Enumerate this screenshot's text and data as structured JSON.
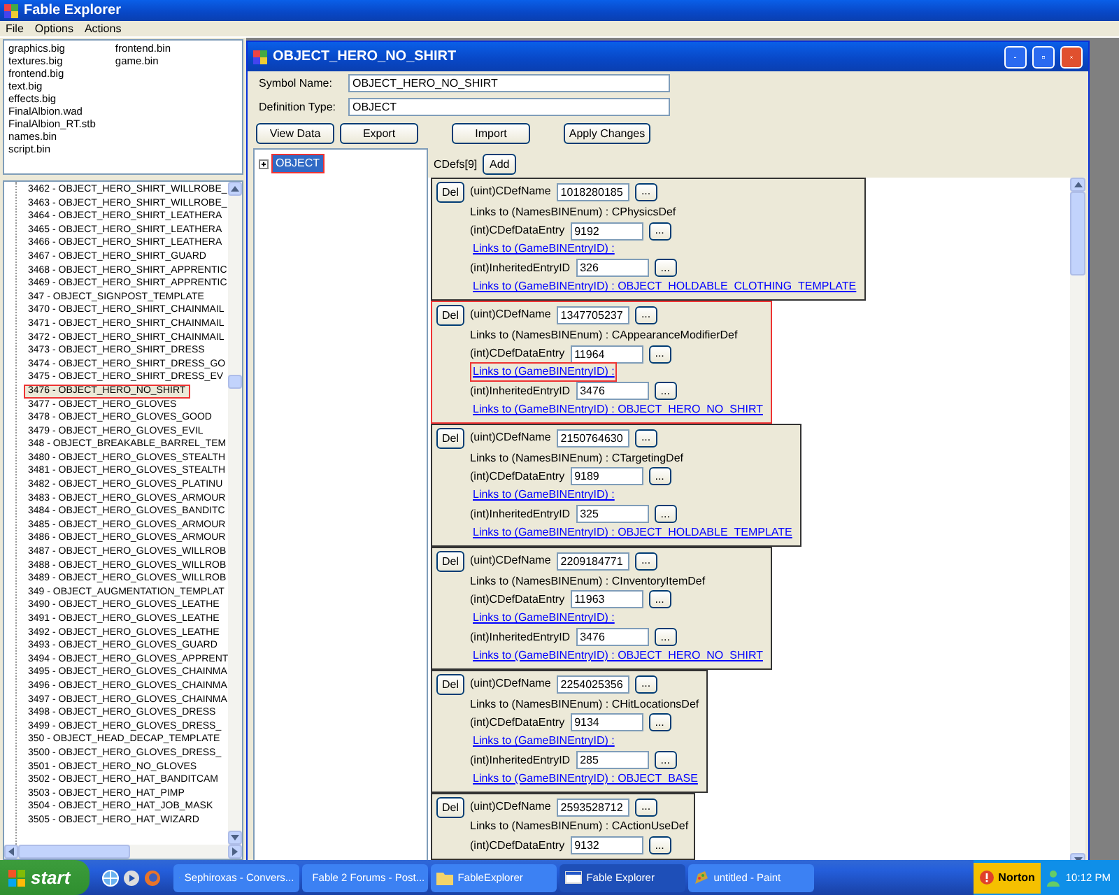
{
  "window": {
    "title": "Fable Explorer"
  },
  "menu": [
    {
      "label": "File"
    },
    {
      "label": "Options"
    },
    {
      "label": "Actions"
    }
  ],
  "files": {
    "columns": [
      [
        "graphics.big",
        "textures.big",
        "frontend.big",
        "text.big",
        "effects.big",
        "FinalAlbion.wad",
        "FinalAlbion_RT.stb",
        "names.bin",
        "script.bin"
      ],
      [
        "frontend.bin",
        "game.bin"
      ]
    ]
  },
  "entries": [
    {
      "text": "3462 - OBJECT_HERO_SHIRT_WILLROBE_",
      "selected": false
    },
    {
      "text": "3463 - OBJECT_HERO_SHIRT_WILLROBE_",
      "selected": false
    },
    {
      "text": "3464 - OBJECT_HERO_SHIRT_LEATHERA",
      "selected": false
    },
    {
      "text": "3465 - OBJECT_HERO_SHIRT_LEATHERA",
      "selected": false
    },
    {
      "text": "3466 - OBJECT_HERO_SHIRT_LEATHERA",
      "selected": false
    },
    {
      "text": "3467 - OBJECT_HERO_SHIRT_GUARD",
      "selected": false
    },
    {
      "text": "3468 - OBJECT_HERO_SHIRT_APPRENTIC",
      "selected": false
    },
    {
      "text": "3469 - OBJECT_HERO_SHIRT_APPRENTIC",
      "selected": false
    },
    {
      "text": "347 - OBJECT_SIGNPOST_TEMPLATE",
      "selected": false
    },
    {
      "text": "3470 - OBJECT_HERO_SHIRT_CHAINMAIL",
      "selected": false
    },
    {
      "text": "3471 - OBJECT_HERO_SHIRT_CHAINMAIL",
      "selected": false
    },
    {
      "text": "3472 - OBJECT_HERO_SHIRT_CHAINMAIL",
      "selected": false
    },
    {
      "text": "3473 - OBJECT_HERO_SHIRT_DRESS",
      "selected": false
    },
    {
      "text": "3474 - OBJECT_HERO_SHIRT_DRESS_GO",
      "selected": false
    },
    {
      "text": "3475 - OBJECT_HERO_SHIRT_DRESS_EV",
      "selected": false
    },
    {
      "text": "3476 - OBJECT_HERO_NO_SHIRT",
      "selected": true
    },
    {
      "text": "3477 - OBJECT_HERO_GLOVES",
      "selected": false
    },
    {
      "text": "3478 - OBJECT_HERO_GLOVES_GOOD",
      "selected": false
    },
    {
      "text": "3479 - OBJECT_HERO_GLOVES_EVIL",
      "selected": false
    },
    {
      "text": "348 - OBJECT_BREAKABLE_BARREL_TEM",
      "selected": false
    },
    {
      "text": "3480 - OBJECT_HERO_GLOVES_STEALTH",
      "selected": false
    },
    {
      "text": "3481 - OBJECT_HERO_GLOVES_STEALTH",
      "selected": false
    },
    {
      "text": "3482 - OBJECT_HERO_GLOVES_PLATINU",
      "selected": false
    },
    {
      "text": "3483 - OBJECT_HERO_GLOVES_ARMOUR",
      "selected": false
    },
    {
      "text": "3484 - OBJECT_HERO_GLOVES_BANDITC",
      "selected": false
    },
    {
      "text": "3485 - OBJECT_HERO_GLOVES_ARMOUR",
      "selected": false
    },
    {
      "text": "3486 - OBJECT_HERO_GLOVES_ARMOUR",
      "selected": false
    },
    {
      "text": "3487 - OBJECT_HERO_GLOVES_WILLROB",
      "selected": false
    },
    {
      "text": "3488 - OBJECT_HERO_GLOVES_WILLROB",
      "selected": false
    },
    {
      "text": "3489 - OBJECT_HERO_GLOVES_WILLROB",
      "selected": false
    },
    {
      "text": "349 - OBJECT_AUGMENTATION_TEMPLAT",
      "selected": false
    },
    {
      "text": "3490 - OBJECT_HERO_GLOVES_LEATHE",
      "selected": false
    },
    {
      "text": "3491 - OBJECT_HERO_GLOVES_LEATHE",
      "selected": false
    },
    {
      "text": "3492 - OBJECT_HERO_GLOVES_LEATHE",
      "selected": false
    },
    {
      "text": "3493 - OBJECT_HERO_GLOVES_GUARD",
      "selected": false
    },
    {
      "text": "3494 - OBJECT_HERO_GLOVES_APPRENT",
      "selected": false
    },
    {
      "text": "3495 - OBJECT_HERO_GLOVES_CHAINMA",
      "selected": false
    },
    {
      "text": "3496 - OBJECT_HERO_GLOVES_CHAINMA",
      "selected": false
    },
    {
      "text": "3497 - OBJECT_HERO_GLOVES_CHAINMA",
      "selected": false
    },
    {
      "text": "3498 - OBJECT_HERO_GLOVES_DRESS",
      "selected": false
    },
    {
      "text": "3499 - OBJECT_HERO_GLOVES_DRESS_",
      "selected": false
    },
    {
      "text": "350 - OBJECT_HEAD_DECAP_TEMPLATE",
      "selected": false
    },
    {
      "text": "3500 - OBJECT_HERO_GLOVES_DRESS_",
      "selected": false
    },
    {
      "text": "3501 - OBJECT_HERO_NO_GLOVES",
      "selected": false
    },
    {
      "text": "3502 - OBJECT_HERO_HAT_BANDITCAM",
      "selected": false
    },
    {
      "text": "3503 - OBJECT_HERO_HAT_PIMP",
      "selected": false
    },
    {
      "text": "3504 - OBJECT_HERO_HAT_JOB_MASK",
      "selected": false
    },
    {
      "text": "3505 - OBJECT_HERO_HAT_WIZARD",
      "selected": false
    }
  ],
  "editor": {
    "title": "OBJECT_HERO_NO_SHIRT",
    "fields": [
      {
        "label": "Symbol Name:",
        "value": "OBJECT_HERO_NO_SHIRT"
      },
      {
        "label": "Definition Type:",
        "value": "OBJECT"
      }
    ],
    "buttons": [
      {
        "label": "View Data"
      },
      {
        "label": "Export"
      },
      {
        "label": "Import"
      },
      {
        "label": "Apply Changes"
      }
    ],
    "tree": [
      {
        "label": "OBJECT",
        "selected": true
      }
    ],
    "cdefs_label": "CDefs[9]",
    "add_button": "Add",
    "cdefs": [
      {
        "highlighted": false,
        "del": "Del",
        "rows": [
          {
            "kind": "field",
            "label": "(uint)CDefName",
            "value": "1018280185",
            "button": "..."
          },
          {
            "kind": "text",
            "text": "Links to (NamesBINEnum) : CPhysicsDef"
          },
          {
            "kind": "field",
            "label": "(int)CDefDataEntry",
            "value": "9192",
            "button": "..."
          },
          {
            "kind": "link",
            "text": "Links to (GameBINEntryID) :",
            "highlighted": false
          },
          {
            "kind": "field",
            "label": "(int)InheritedEntryID",
            "value": "326",
            "button": "..."
          },
          {
            "kind": "link",
            "text": "Links to (GameBINEntryID) : OBJECT_HOLDABLE_CLOTHING_TEMPLATE",
            "highlighted": false
          }
        ]
      },
      {
        "highlighted": true,
        "del": "Del",
        "rows": [
          {
            "kind": "field",
            "label": "(uint)CDefName",
            "value": "1347705237",
            "button": "..."
          },
          {
            "kind": "text",
            "text": "Links to (NamesBINEnum) : CAppearanceModifierDef"
          },
          {
            "kind": "field",
            "label": "(int)CDefDataEntry",
            "value": "11964",
            "button": "..."
          },
          {
            "kind": "link",
            "text": "Links to (GameBINEntryID) :",
            "highlighted": true
          },
          {
            "kind": "field",
            "label": "(int)InheritedEntryID",
            "value": "3476",
            "button": "..."
          },
          {
            "kind": "link",
            "text": "Links to (GameBINEntryID) : OBJECT_HERO_NO_SHIRT",
            "highlighted": false
          }
        ]
      },
      {
        "highlighted": false,
        "del": "Del",
        "rows": [
          {
            "kind": "field",
            "label": "(uint)CDefName",
            "value": "2150764630",
            "button": "..."
          },
          {
            "kind": "text",
            "text": "Links to (NamesBINEnum) : CTargetingDef"
          },
          {
            "kind": "field",
            "label": "(int)CDefDataEntry",
            "value": "9189",
            "button": "..."
          },
          {
            "kind": "link",
            "text": "Links to (GameBINEntryID) :",
            "highlighted": false
          },
          {
            "kind": "field",
            "label": "(int)InheritedEntryID",
            "value": "325",
            "button": "..."
          },
          {
            "kind": "link",
            "text": "Links to (GameBINEntryID) : OBJECT_HOLDABLE_TEMPLATE",
            "highlighted": false
          }
        ]
      },
      {
        "highlighted": false,
        "del": "Del",
        "rows": [
          {
            "kind": "field",
            "label": "(uint)CDefName",
            "value": "2209184771",
            "button": "..."
          },
          {
            "kind": "text",
            "text": "Links to (NamesBINEnum) : CInventoryItemDef"
          },
          {
            "kind": "field",
            "label": "(int)CDefDataEntry",
            "value": "11963",
            "button": "..."
          },
          {
            "kind": "link",
            "text": "Links to (GameBINEntryID) :",
            "highlighted": false
          },
          {
            "kind": "field",
            "label": "(int)InheritedEntryID",
            "value": "3476",
            "button": "..."
          },
          {
            "kind": "link",
            "text": "Links to (GameBINEntryID) : OBJECT_HERO_NO_SHIRT",
            "highlighted": false
          }
        ]
      },
      {
        "highlighted": false,
        "del": "Del",
        "rows": [
          {
            "kind": "field",
            "label": "(uint)CDefName",
            "value": "2254025356",
            "button": "..."
          },
          {
            "kind": "text",
            "text": "Links to (NamesBINEnum) : CHitLocationsDef"
          },
          {
            "kind": "field",
            "label": "(int)CDefDataEntry",
            "value": "9134",
            "button": "..."
          },
          {
            "kind": "link",
            "text": "Links to (GameBINEntryID) :",
            "highlighted": false
          },
          {
            "kind": "field",
            "label": "(int)InheritedEntryID",
            "value": "285",
            "button": "..."
          },
          {
            "kind": "link",
            "text": "Links to (GameBINEntryID) : OBJECT_BASE",
            "highlighted": false
          }
        ]
      },
      {
        "highlighted": false,
        "del": "Del",
        "rows": [
          {
            "kind": "field",
            "label": "(uint)CDefName",
            "value": "2593528712",
            "button": "..."
          },
          {
            "kind": "text",
            "text": "Links to (NamesBINEnum) : CActionUseDef"
          },
          {
            "kind": "field",
            "label": "(int)CDefDataEntry",
            "value": "9132",
            "button": "..."
          }
        ]
      }
    ]
  },
  "taskbar": {
    "start": "start",
    "tasks": [
      {
        "kind": "chat",
        "label": "Sephiroxas - Convers...",
        "selected": false
      },
      {
        "kind": "browser",
        "label": "Fable 2 Forums - Post...",
        "selected": false
      },
      {
        "kind": "folder",
        "label": "FableExplorer",
        "selected": false
      },
      {
        "kind": "app",
        "label": "Fable Explorer",
        "selected": true
      },
      {
        "kind": "paint",
        "label": "untitled - Paint",
        "selected": false
      }
    ],
    "norton": "Norton",
    "time": "10:12 PM"
  }
}
